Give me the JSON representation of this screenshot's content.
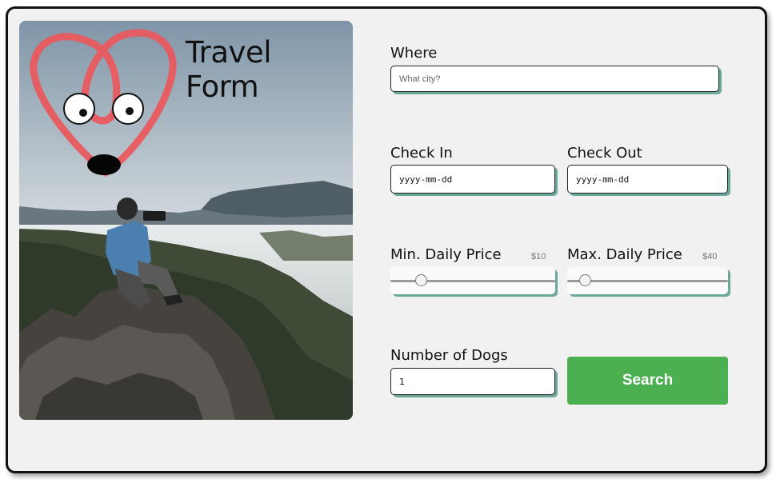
{
  "header": {
    "title": "Travel Form"
  },
  "form": {
    "where": {
      "label": "Where",
      "placeholder": "What city?"
    },
    "check_in": {
      "label": "Check In",
      "value": "yyyy-mm-dd"
    },
    "check_out": {
      "label": "Check Out",
      "value": "yyyy-mm-dd"
    },
    "min_price": {
      "label": "Min. Daily Price",
      "value_text": "$10",
      "level": 0.16
    },
    "max_price": {
      "label": "Max. Daily Price",
      "value_text": "$40",
      "level": 0.08
    },
    "dogs": {
      "label": "Number of Dogs",
      "value": "1"
    },
    "search": {
      "label": "Search"
    }
  },
  "colors": {
    "accent": "#4caf50",
    "shadow": "#6aa89b",
    "logo": "#e85a5e"
  },
  "icons": {
    "logo": "dog-face-logo-icon"
  }
}
